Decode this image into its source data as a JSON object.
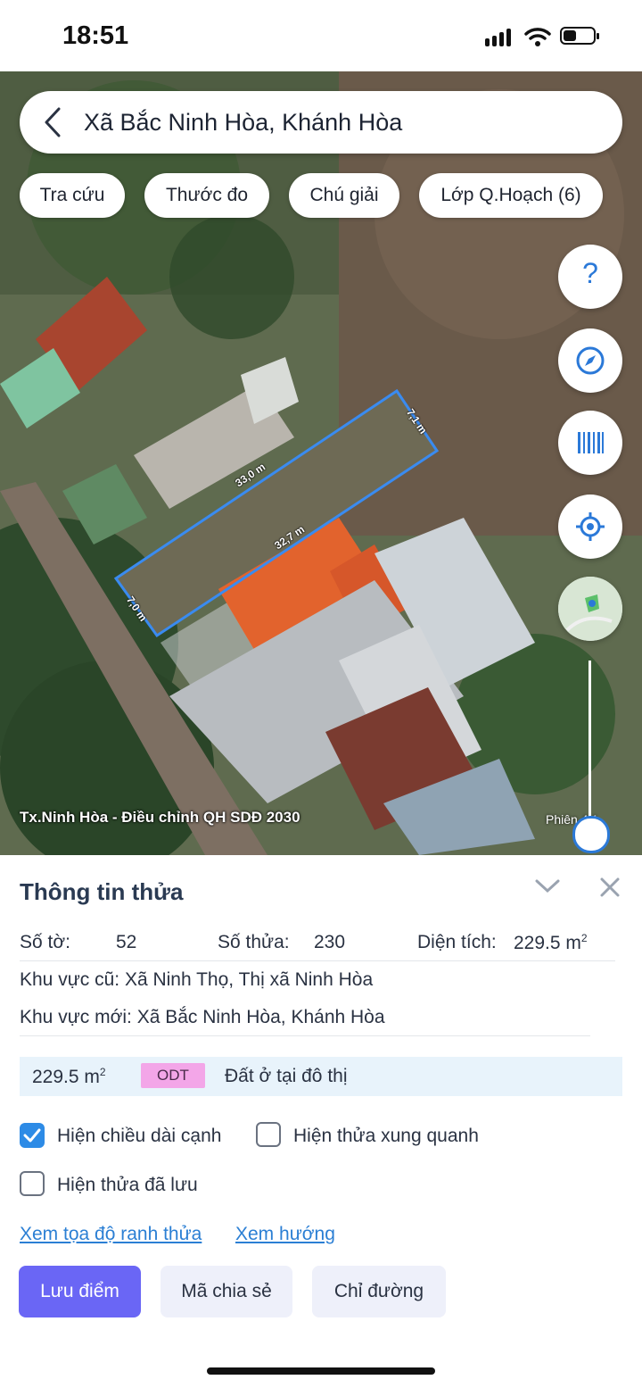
{
  "status_bar": {
    "time": "18:51"
  },
  "search": {
    "query": "Xã Bắc Ninh Hòa, Khánh Hòa"
  },
  "chips": [
    {
      "label": "Tra cứu"
    },
    {
      "label": "Thước đo"
    },
    {
      "label": "Chú giải"
    },
    {
      "label": "Lớp Q.Hoạch (6)"
    }
  ],
  "map_tools": {
    "help_label": "?",
    "buttons": [
      "help-icon",
      "compass-icon",
      "barcode-icon",
      "locate-icon",
      "minimap-icon"
    ]
  },
  "parcel_dims": {
    "top": "33,0 m",
    "right": "7,1 m",
    "middle": "32,7 m",
    "left": "7,0 m"
  },
  "map_labels": {
    "planning": "Tx.Ninh Hòa - Điều chỉnh QH SDĐ 2030",
    "version": "Phiên 4.1"
  },
  "panel": {
    "title": "Thông tin thửa",
    "so_to_label": "Số tờ:",
    "so_to": "52",
    "so_thua_label": "Số thửa:",
    "so_thua": "230",
    "dien_tich_label": "Diện tích:",
    "dien_tich": "229.5 m",
    "sup2": "2",
    "khu_vuc_cu": "Khu vực cũ: Xã Ninh Thọ, Thị xã Ninh Hòa",
    "khu_vuc_moi": "Khu vực mới: Xã Bắc Ninh Hòa, Khánh Hòa",
    "land": {
      "area": "229.5 m",
      "code": "ODT",
      "use": "Đất ở tại đô thị"
    },
    "checkboxes": [
      {
        "label": "Hiện chiều dài cạnh",
        "checked": true
      },
      {
        "label": "Hiện thửa xung quanh",
        "checked": false
      },
      {
        "label": "Hiện thửa đã lưu",
        "checked": false
      }
    ],
    "links": {
      "coords": "Xem tọa độ ranh thửa",
      "direction": "Xem hướng"
    },
    "buttons": {
      "save": "Lưu điểm",
      "share": "Mã chia sẻ",
      "route": "Chỉ đường"
    }
  },
  "colors": {
    "accent": "#6a66f5",
    "link": "#2b7fd4",
    "badge": "#f3a6e8",
    "parcel_line": "#3a8bf0"
  }
}
